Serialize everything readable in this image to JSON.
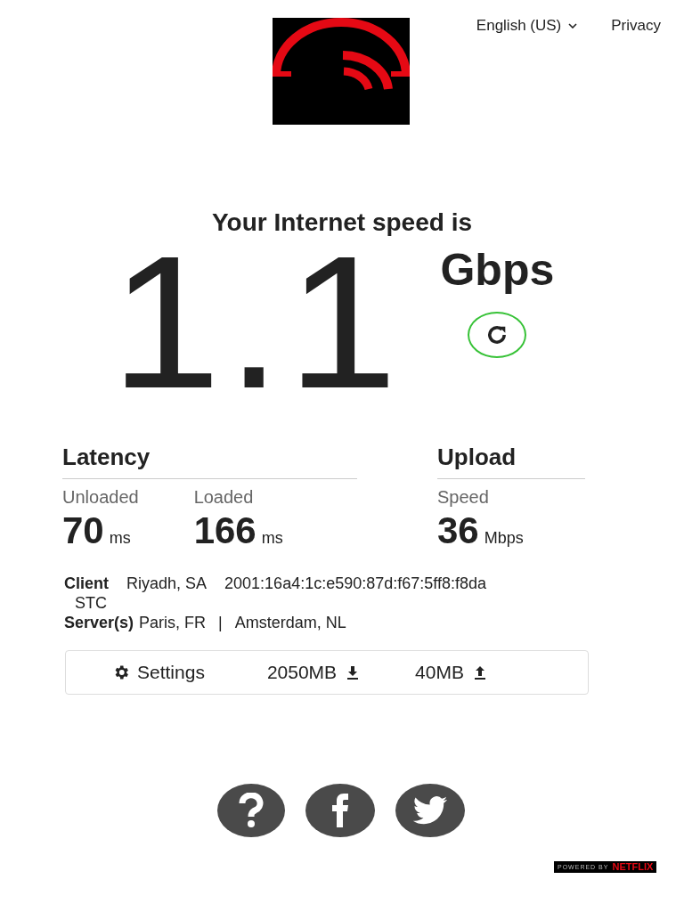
{
  "header": {
    "language": "English (US)",
    "privacy": "Privacy"
  },
  "speed": {
    "heading": "Your Internet speed is",
    "value": "1.1",
    "unit": "Gbps"
  },
  "latency": {
    "title": "Latency",
    "metrics": [
      {
        "label": "Unloaded",
        "value": "70",
        "unit": "ms"
      },
      {
        "label": "Loaded",
        "value": "166",
        "unit": "ms"
      }
    ]
  },
  "upload": {
    "title": "Upload",
    "metrics": [
      {
        "label": "Speed",
        "value": "36",
        "unit": "Mbps"
      }
    ]
  },
  "client": {
    "label": "Client",
    "location": "Riyadh, SA",
    "ip": "2001:16a4:1c:e590:87d:f67:5ff8:f8da",
    "isp": "STC"
  },
  "servers": {
    "label": "Server(s)",
    "locations": [
      "Paris, FR",
      "Amsterdam, NL"
    ],
    "separator": "|"
  },
  "settings_bar": {
    "settings": "Settings",
    "download_size": "2050MB",
    "upload_size": "40MB"
  },
  "footer": {
    "powered_by": "POWERED BY",
    "brand": "NETFLIX"
  }
}
